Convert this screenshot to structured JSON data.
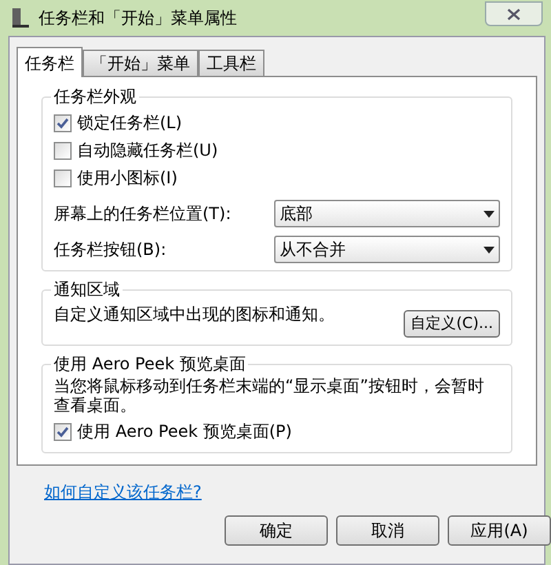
{
  "window": {
    "title": "任务栏和「开始」菜单属性"
  },
  "tabs": [
    {
      "label": "任务栏",
      "selected": true
    },
    {
      "label": "「开始」菜单",
      "selected": false
    },
    {
      "label": "工具栏",
      "selected": false
    }
  ],
  "appearance": {
    "title": "任务栏外观",
    "checkboxes": [
      {
        "label": "锁定任务栏(L)",
        "checked": true
      },
      {
        "label": "自动隐藏任务栏(U)",
        "checked": false
      },
      {
        "label": "使用小图标(I)",
        "checked": false
      }
    ],
    "dropdowns": [
      {
        "label": "屏幕上的任务栏位置(T):",
        "value": "底部"
      },
      {
        "label": "任务栏按钮(B):",
        "value": "从不合并"
      }
    ]
  },
  "notification_area": {
    "title": "通知区域",
    "description": "自定义通知区域中出现的图标和通知。",
    "button": "自定义(C)..."
  },
  "aero_peek": {
    "title": "使用 Aero Peek 预览桌面",
    "description": "当您将鼠标移动到任务栏末端的“显示桌面”按钮时，会暂时查看桌面。",
    "checkbox": {
      "label": "使用 Aero Peek 预览桌面(P)",
      "checked": true
    }
  },
  "help_link": "如何自定义该任务栏?",
  "buttons": [
    "确定",
    "取消",
    "应用(A)"
  ]
}
